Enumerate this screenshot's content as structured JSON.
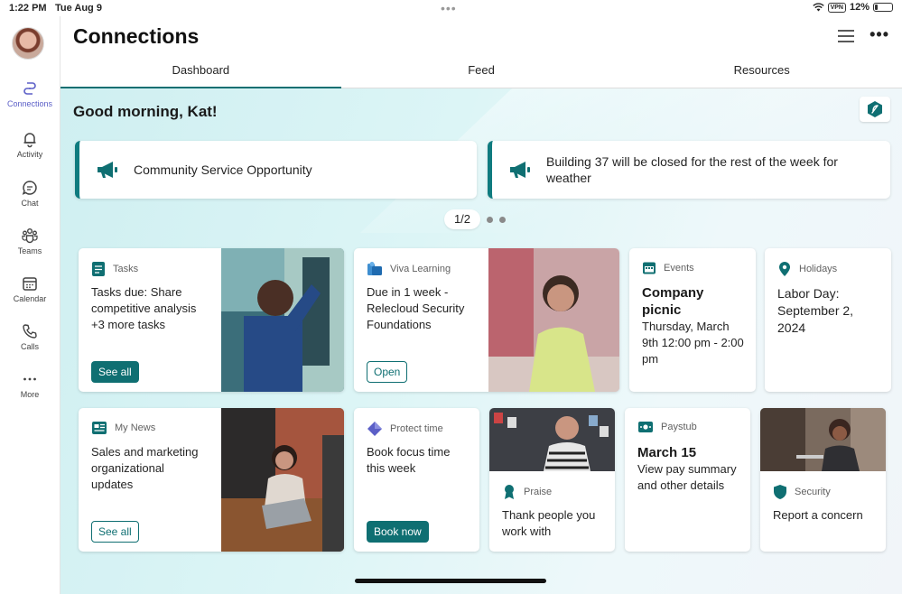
{
  "status_bar": {
    "time": "1:22 PM",
    "date": "Tue Aug 9",
    "vpn": "VPN",
    "battery": "12%"
  },
  "sidebar": {
    "items": [
      {
        "label": "Connections",
        "icon": "connections-icon"
      },
      {
        "label": "Activity",
        "icon": "bell-icon"
      },
      {
        "label": "Chat",
        "icon": "chat-icon"
      },
      {
        "label": "Teams",
        "icon": "teams-icon"
      },
      {
        "label": "Calendar",
        "icon": "calendar-icon"
      },
      {
        "label": "Calls",
        "icon": "phone-icon"
      },
      {
        "label": "More",
        "icon": "more-icon"
      }
    ]
  },
  "header": {
    "title": "Connections",
    "tabs": [
      {
        "label": "Dashboard"
      },
      {
        "label": "Feed"
      },
      {
        "label": "Resources"
      }
    ]
  },
  "dashboard": {
    "greeting": "Good morning, Kat!",
    "announcements": [
      {
        "text": "Community Service Opportunity"
      },
      {
        "text": "Building 37 will be closed for the rest of the week for weather"
      }
    ],
    "pager": "1/2",
    "cards": {
      "tasks": {
        "label": "Tasks",
        "body": "Tasks due: Share competitive analysis +3 more tasks",
        "button": "See all"
      },
      "learning": {
        "label": "Viva Learning",
        "body": "Due in 1 week - Relecloud Security Foundations",
        "button": "Open"
      },
      "events": {
        "label": "Events",
        "title": "Company picnic",
        "body": "Thursday, March 9th 12:00 pm - 2:00 pm"
      },
      "holidays": {
        "label": "Holidays",
        "title": "Labor Day: September 2, 2024"
      },
      "news": {
        "label": "My News",
        "body": "Sales and marketing organizational updates",
        "button": "See all"
      },
      "protect": {
        "label": "Protect time",
        "body": "Book focus time this week",
        "button": "Book now"
      },
      "praise": {
        "label": "Praise",
        "body": "Thank people you work with"
      },
      "paystub": {
        "label": "Paystub",
        "title": "March 15",
        "body": "View pay summary and other details"
      },
      "security": {
        "label": "Security",
        "body": "Report a concern"
      }
    }
  },
  "colors": {
    "accent": "#0f6f72",
    "teams_purple": "#5b5fc7"
  }
}
